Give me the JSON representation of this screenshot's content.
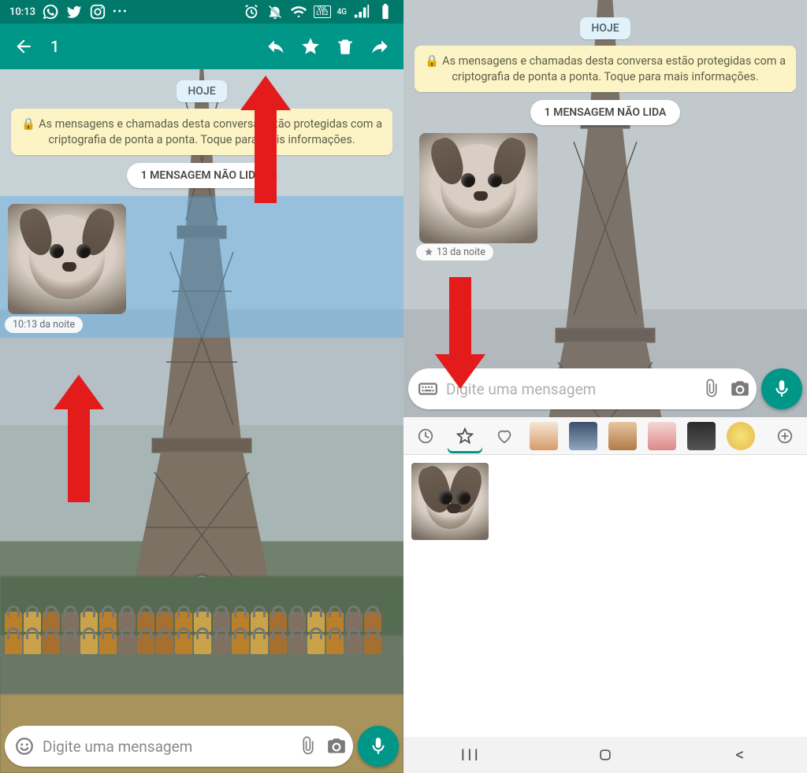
{
  "statusbar": {
    "time": "10:13",
    "network": "4G",
    "lte_label": "LTE2",
    "volte_label": "VoL"
  },
  "actionbar": {
    "selected_count": "1"
  },
  "chat": {
    "date_label": "HOJE",
    "encryption_notice": "As mensagens e chamadas desta conversa estão protegidas com a criptografia de ponta a ponta. Toque para mais informações.",
    "unread_label": "1 MENSAGEM NÃO LIDA",
    "message_time_left": "10:13 da noite",
    "message_time_right": "13 da noite"
  },
  "input": {
    "placeholder": "Digite uma mensagem"
  },
  "colors": {
    "toolbar": "#009688",
    "statusbar": "#00796b",
    "arrow": "#e41b1b",
    "banner": "#fdf4c5",
    "selection": "rgba(90,170,225,.45)"
  }
}
